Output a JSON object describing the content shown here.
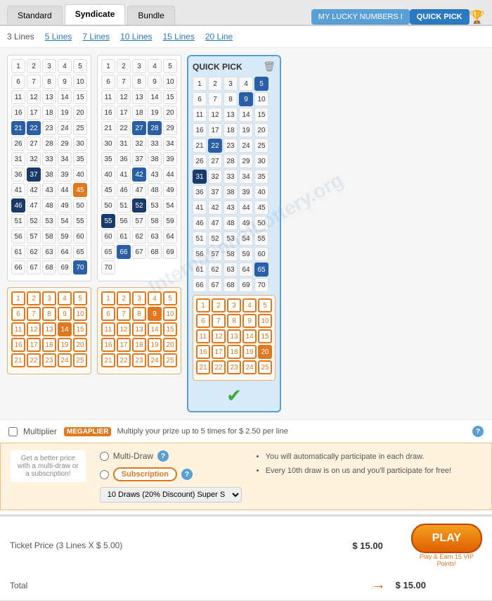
{
  "tabs": [
    {
      "label": "Standard",
      "active": false
    },
    {
      "label": "Syndicate",
      "active": true
    },
    {
      "label": "Bundle",
      "active": false
    }
  ],
  "header": {
    "lucky_btn": "MY LUCKY NUMBERS I",
    "quick_pick_btn": "QUICK PICK"
  },
  "lines_nav": {
    "prefix": "3 Lines",
    "links": [
      "5 Lines",
      "7 Lines",
      "10 Lines",
      "15 Lines",
      "20 Line"
    ]
  },
  "quick_pick": {
    "title": "QUICK PICK",
    "trash_label": "🗑"
  },
  "multiplier": {
    "label": "Multiply your prize up to 5 times for $ 2.50 per line",
    "badge": "MEGAPLIER"
  },
  "options": {
    "left_text": "Get a better price\nwith a multi-draw or\na subscription!",
    "multi_draw_label": "Multi-Draw",
    "subscription_label": "Subscription",
    "draw_select": "10 Draws (20% Discount) Super S",
    "bullets": [
      "You will automatically participate in each draw.",
      "Every 10th draw is on us and you'll participate for free!"
    ]
  },
  "ticket": {
    "price_label": "Ticket Price (3 Lines X $ 5.00)",
    "price_value": "$ 15.00",
    "total_label": "Total",
    "total_value": "$ 15.00"
  },
  "play_btn": "PLAY",
  "play_sub": "Play & Earn 15 VIP\nPoints!"
}
